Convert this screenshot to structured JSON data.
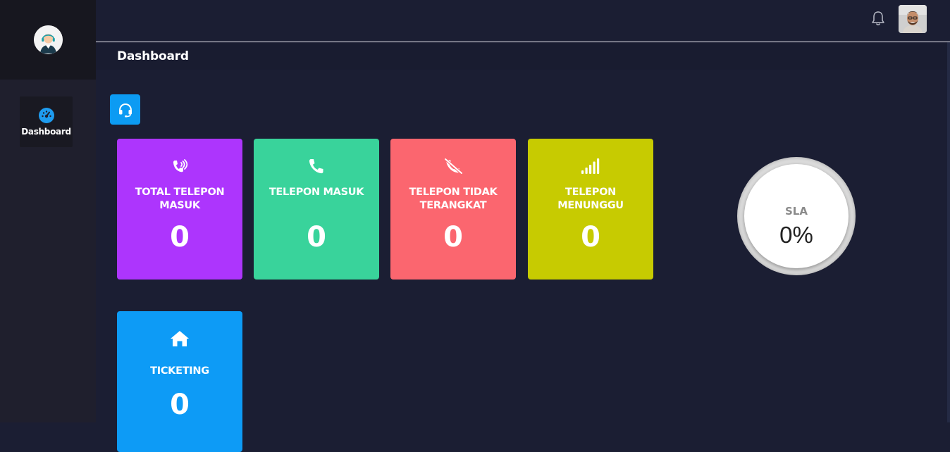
{
  "sidebar": {
    "avatar_icon": "agent-headset-avatar",
    "nav": [
      {
        "label": "Dashboard",
        "icon": "speedometer-icon",
        "color": "#1e9cf0"
      }
    ]
  },
  "header": {
    "bell_icon": "bell-icon",
    "user_avatar": "user-photo"
  },
  "page": {
    "title": "Dashboard",
    "badge_icon": "headset-icon"
  },
  "cards": [
    {
      "label": "TOTAL TELEPON MASUK",
      "value": "0",
      "color": "#ad35fd",
      "icon": "phone-volume-icon"
    },
    {
      "label": "TELEPON MASUK",
      "value": "0",
      "color": "#39d39b",
      "icon": "phone-icon"
    },
    {
      "label": "TELEPON TIDAK TERANGKAT",
      "value": "0",
      "color": "#fb666f",
      "icon": "phone-slash-icon"
    },
    {
      "label": "TELEPON MENUNGGU",
      "value": "0",
      "color": "#c7cb01",
      "icon": "signal-icon"
    },
    {
      "label": "TICKETING",
      "value": "0",
      "color": "#0d9bf6",
      "icon": "home-icon"
    }
  ],
  "sla": {
    "label": "SLA",
    "value": "0%"
  }
}
